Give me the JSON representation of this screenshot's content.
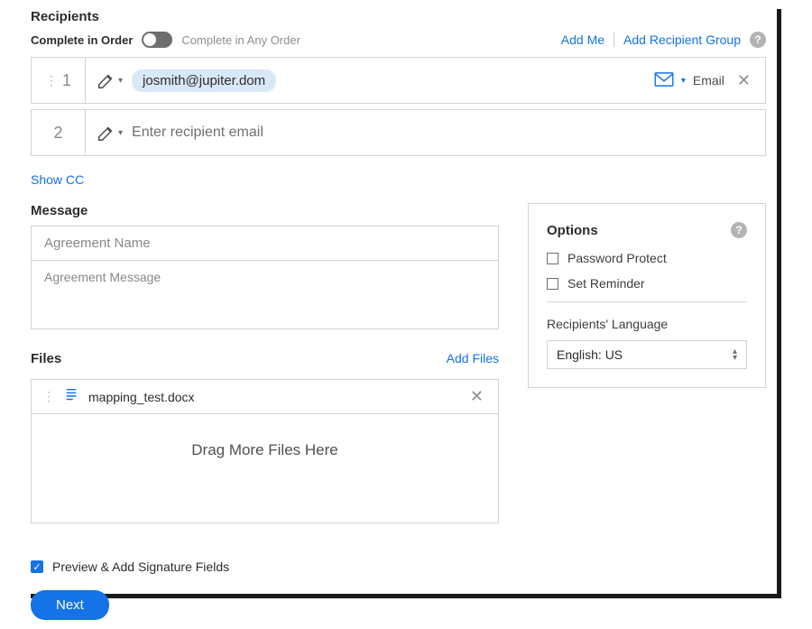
{
  "recipients": {
    "heading": "Recipients",
    "complete_in_order": "Complete in Order",
    "complete_any_order": "Complete in Any Order",
    "add_me": "Add Me",
    "add_recipient_group": "Add Recipient Group",
    "rows": [
      {
        "num": "1",
        "email_chip": "josmith@jupiter.dom",
        "delivery_label": "Email",
        "placeholder": ""
      },
      {
        "num": "2",
        "email_chip": "",
        "delivery_label": "",
        "placeholder": "Enter recipient email"
      }
    ],
    "show_cc": "Show CC"
  },
  "message": {
    "heading": "Message",
    "name_placeholder": "Agreement Name",
    "msg_placeholder": "Agreement Message"
  },
  "files": {
    "heading": "Files",
    "add_files": "Add Files",
    "items": [
      {
        "name": "mapping_test.docx"
      }
    ],
    "drop_hint": "Drag More Files Here"
  },
  "options": {
    "heading": "Options",
    "password_protect": "Password Protect",
    "set_reminder": "Set Reminder",
    "lang_label": "Recipients' Language",
    "lang_value": "English: US"
  },
  "footer": {
    "preview_label": "Preview & Add Signature Fields",
    "next": "Next"
  }
}
